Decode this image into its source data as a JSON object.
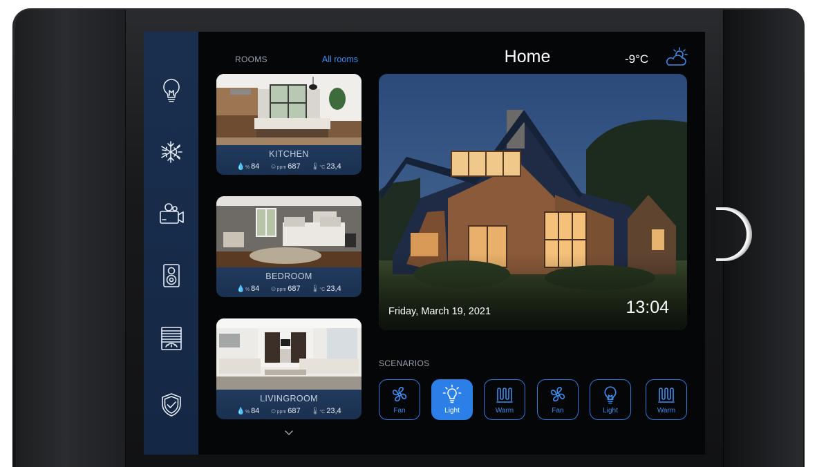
{
  "header": {
    "title": "Home",
    "temperature": "-9°C",
    "weather_icon": "partly-cloudy-sun-icon"
  },
  "rooms": {
    "section_label": "ROOMS",
    "all_rooms_link": "All rooms",
    "items": [
      {
        "name": "KITCHEN",
        "humidity_unit": "%",
        "humidity": "84",
        "air_unit": "ppm",
        "air": "687",
        "temp_unit": "°C",
        "temp": "23,4"
      },
      {
        "name": "BEDROOM",
        "humidity_unit": "%",
        "humidity": "84",
        "air_unit": "ppm",
        "air": "687",
        "temp_unit": "°C",
        "temp": "23,4"
      },
      {
        "name": "LIVINGROOM",
        "humidity_unit": "%",
        "humidity": "84",
        "air_unit": "ppm",
        "air": "687",
        "temp_unit": "°C",
        "temp": "23,4"
      }
    ]
  },
  "sidebar": {
    "items": [
      {
        "icon": "lightbulb-icon"
      },
      {
        "icon": "climate-icon"
      },
      {
        "icon": "camera-icon"
      },
      {
        "icon": "speaker-icon"
      },
      {
        "icon": "blinds-icon"
      },
      {
        "icon": "shield-icon"
      }
    ]
  },
  "hero": {
    "date": "Friday, March 19, 2021",
    "time": "13:04"
  },
  "scenarios": {
    "section_label": "SCENARIOS",
    "items": [
      {
        "label": "Fan",
        "icon": "fan-icon",
        "active": false
      },
      {
        "label": "Light",
        "icon": "light-icon",
        "active": true
      },
      {
        "label": "Warm",
        "icon": "heater-icon",
        "active": false
      },
      {
        "label": "Fan",
        "icon": "fan-icon",
        "active": false
      },
      {
        "label": "Light",
        "icon": "light-icon",
        "active": false
      },
      {
        "label": "Warm",
        "icon": "heater-icon",
        "active": false
      }
    ]
  },
  "colors": {
    "accent": "#2b7fe6",
    "sidebar": "#1a2f4e",
    "background": "#050608"
  }
}
